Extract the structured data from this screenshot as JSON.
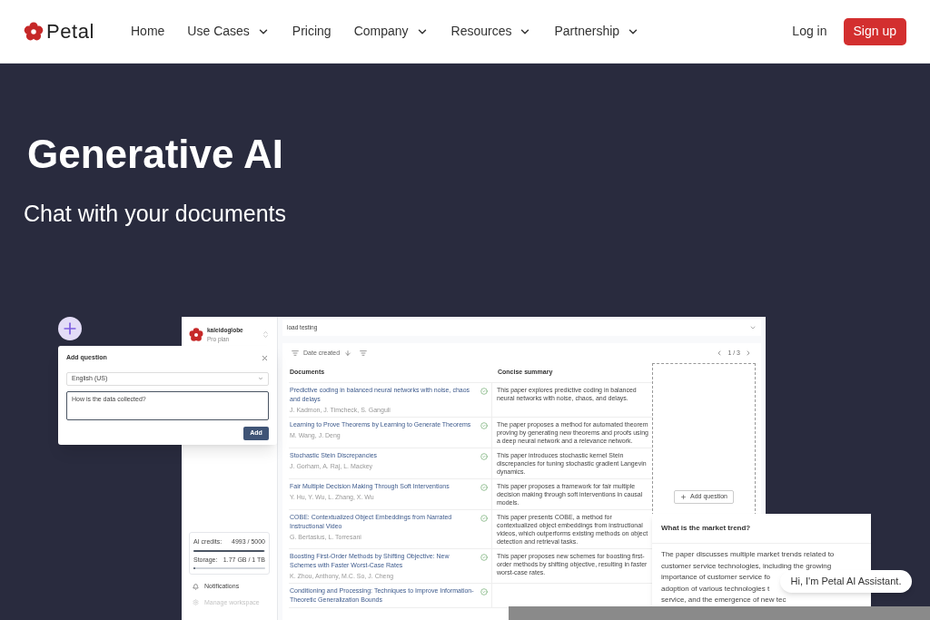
{
  "nav": {
    "logo": "Petal",
    "items": [
      {
        "label": "Home",
        "has_menu": false
      },
      {
        "label": "Use Cases",
        "has_menu": true
      },
      {
        "label": "Pricing",
        "has_menu": false
      },
      {
        "label": "Company",
        "has_menu": true
      },
      {
        "label": "Resources",
        "has_menu": true
      },
      {
        "label": "Partnership",
        "has_menu": true
      }
    ],
    "auth": [
      {
        "label": "Log in",
        "kind": "link"
      },
      {
        "label": "Sign up",
        "kind": "primary"
      }
    ]
  },
  "hero": {
    "title": "Generative AI",
    "subtitle": "Chat with your documents"
  },
  "app": {
    "workspace": {
      "name": "kaleidoglobe",
      "plan": "Pro plan"
    },
    "usage": [
      {
        "label": "AI credits:",
        "value": "4993 / 5000",
        "level": 0.99
      },
      {
        "label": "Storage:",
        "value": "1.77 GB / 1 TB",
        "level": 0.02
      }
    ],
    "sidebar_items": [
      {
        "label": "Notifications",
        "disabled": false
      },
      {
        "label": "Manage workspace",
        "disabled": true
      }
    ],
    "project": "load testing",
    "sort": "Date created",
    "pagination": "1 / 3",
    "columns": [
      "Documents",
      "Concise summary"
    ],
    "documents": [
      {
        "title": "Predictive coding in balanced neural networks with noise, chaos and delays",
        "authors": "J. Kadmon, J. Timcheck, S. Ganguli",
        "processed": true,
        "summary": "This paper explores predictive coding in balanced neural networks with noise, chaos, and delays."
      },
      {
        "title": "Learning to Prove Theorems by Learning to Generate Theorems",
        "authors": "M. Wang, J. Deng",
        "processed": true,
        "summary": "The paper proposes a method for automated theorem proving by generating new theorems and proofs using a deep neural network and a relevance network."
      },
      {
        "title": "Stochastic Stein Discrepancies",
        "authors": "J. Gorham, A. Raj, L. Mackey",
        "processed": true,
        "summary": "This paper introduces stochastic kernel Stein discrepancies for tuning stochastic gradient Langevin dynamics."
      },
      {
        "title": "Fair Multiple Decision Making Through Soft Interventions",
        "authors": "Y. Hu, Y. Wu, L. Zhang, X. Wu",
        "processed": true,
        "summary": "This paper proposes a framework for fair multiple decision making through soft interventions in causal models."
      },
      {
        "title": "COBE: Contextualized Object Embeddings from Narrated Instructional Video",
        "authors": "G. Bertasius, L. Torresani",
        "processed": true,
        "summary": "This paper presents COBE, a method for contextualized object embeddings from instructional videos, which outperforms existing methods on object detection and retrieval tasks."
      },
      {
        "title": "Boosting First-Order Methods by Shifting Objective: New Schemes with Faster Worst-Case Rates",
        "authors": "K. Zhou, Anthony, M.C. So, J. Cheng",
        "processed": true,
        "summary": "This paper proposes new schemes for boosting first-order methods by shifting objective, resulting in faster worst-case rates."
      },
      {
        "title": "Conditioning and Processing: Techniques to Improve Information-Theoretic Generalization Bounds",
        "processed": true
      }
    ],
    "add_question_button": "Add question"
  },
  "dialog": {
    "title": "Add question",
    "language": "English (US)",
    "question": "How is the data collected?",
    "submit": "Add"
  },
  "answer": {
    "question": "What is the market trend?",
    "lines": [
      "The paper discusses multiple market trends related to",
      "customer service technologies, including the growing",
      "importance of customer service fo",
      "adoption of various technologies t",
      "service, and the emergence of new tec"
    ]
  },
  "assistant": {
    "message": "Hi, I'm Petal AI Assistant."
  }
}
